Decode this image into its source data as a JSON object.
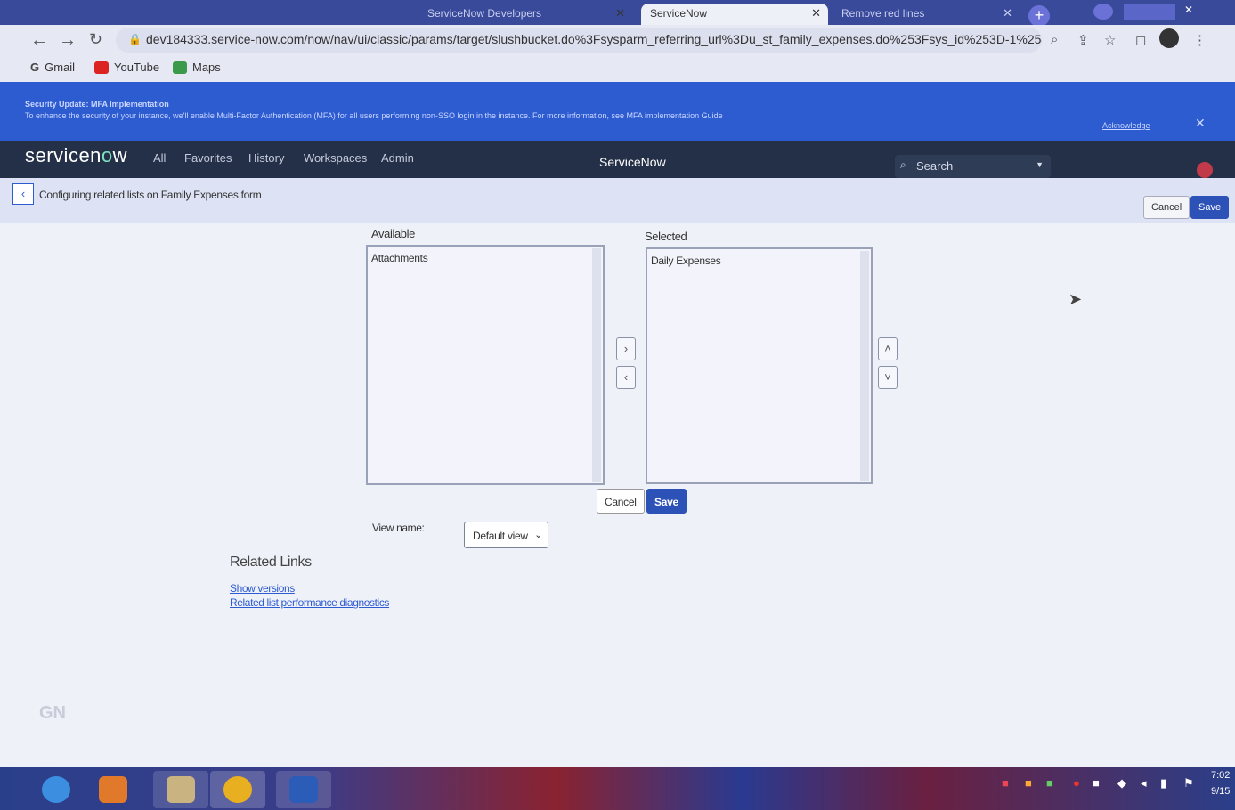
{
  "browser": {
    "tabs": [
      {
        "label": "ServiceNow Developers"
      },
      {
        "label": "ServiceNow"
      },
      {
        "label": "Remove red lines"
      }
    ],
    "url": "dev184333.service-now.com/now/nav/ui/classic/params/target/slushbucket.do%3Fsysparm_referring_url%3Du_st_family_expenses.do%253Fsys_id%253D-1%25409...",
    "bookmarks": [
      {
        "label": "Gmail"
      },
      {
        "label": "YouTube"
      },
      {
        "label": "Maps"
      }
    ]
  },
  "banner": {
    "title": "Security Update: MFA Implementation",
    "text": "To enhance the security of your instance, we'll enable Multi-Factor Authentication (MFA) for all users performing non-SSO login in the instance. For more information, see MFA implementation Guide",
    "acknowledge": "Acknowledge"
  },
  "nav": {
    "logo_prefix": "servicen",
    "logo_o": "o",
    "logo_suffix": "w",
    "items": [
      {
        "label": "All"
      },
      {
        "label": "Favorites"
      },
      {
        "label": "History"
      },
      {
        "label": "Workspaces"
      },
      {
        "label": "Admin"
      }
    ],
    "center_title": "ServiceNow",
    "search_placeholder": "Search"
  },
  "form": {
    "title": "Configuring related lists on Family Expenses form",
    "cancel": "Cancel",
    "save": "Save"
  },
  "slushbucket": {
    "available_label": "Available",
    "available_items": [
      "Attachments"
    ],
    "selected_label": "Selected",
    "selected_items": [
      "Daily Expenses"
    ],
    "cancel": "Cancel",
    "save": "Save",
    "view_name_label": "View name:",
    "view_name_value": "Default view"
  },
  "related_links": {
    "title": "Related Links",
    "links": [
      {
        "label": "Show versions"
      },
      {
        "label": "Related list performance diagnostics"
      }
    ]
  },
  "watermark": "GN",
  "tray": {
    "time": "7:02",
    "date": "9/15"
  }
}
